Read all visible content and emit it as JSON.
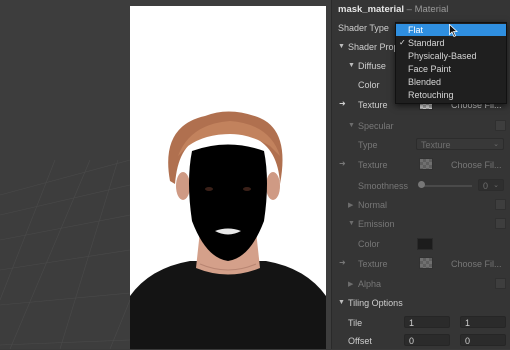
{
  "header": {
    "asset_name": "mask_material",
    "separator": " – ",
    "asset_type": "Material"
  },
  "shader_type": {
    "label": "Shader Type"
  },
  "dropdown": {
    "selected": "Standard",
    "highlighted": "Flat",
    "options": [
      "Flat",
      "Standard",
      "Physically-Based",
      "Face Paint",
      "Blended",
      "Retouching"
    ]
  },
  "sections": {
    "shader_properties": "Shader Prop",
    "diffuse": {
      "label": "Diffuse",
      "color_label": "Color",
      "texture_label": "Texture",
      "texture_value": "Choose Fil..."
    },
    "specular": {
      "label": "Specular",
      "type_label": "Type",
      "type_value": "Texture",
      "texture_label": "Texture",
      "texture_value": "Choose Fil...",
      "smoothness_label": "Smoothness",
      "smoothness_value": "0"
    },
    "normal": {
      "label": "Normal"
    },
    "emission": {
      "label": "Emission",
      "color_label": "Color",
      "texture_label": "Texture",
      "texture_value": "Choose Fil..."
    },
    "alpha": {
      "label": "Alpha"
    },
    "tiling": {
      "label": "Tiling Options",
      "tile_label": "Tile",
      "tile_x": "1",
      "tile_y": "1",
      "offset_label": "Offset",
      "offset_x": "0",
      "offset_y": "0"
    }
  },
  "colors": {
    "accent": "#2f8fe0",
    "panel": "#353535",
    "viewport": "#3d3d3d",
    "mask": "#000000",
    "hair": "#b0704f",
    "skin": "#d9a58f"
  }
}
